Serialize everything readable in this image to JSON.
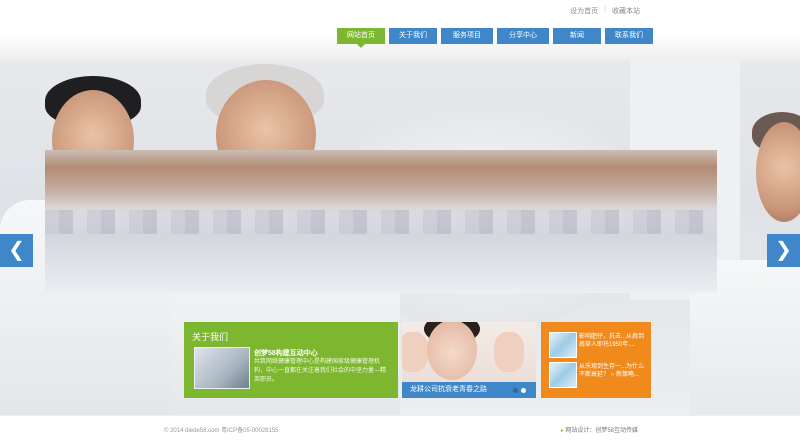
{
  "top_links": {
    "home": "设为首页",
    "favorite": "收藏本站"
  },
  "nav": [
    {
      "label": "网站首页",
      "active": true
    },
    {
      "label": "关于我们"
    },
    {
      "label": "服务项目"
    },
    {
      "label": "分享中心"
    },
    {
      "label": "新闻"
    },
    {
      "label": "联系我们"
    }
  ],
  "slider": {
    "prev": "❮",
    "next": "❯"
  },
  "about": {
    "title": "关于我们",
    "subtitle": "创梦58构建互动中心",
    "description": "共筑网络健康管理中心是构建国家级健康管理机构，中心一直都在关注着我们社会的中坚力量—精英职员。"
  },
  "feature": {
    "caption": "龙耕公司抗衰老青春之路"
  },
  "news": [
    {
      "text": "影响肥仔，抗击...从肩到肩穿人即托1950年...."
    },
    {
      "text": "从乐观到生存一...为什么不断衰延？ ○ 新策略..."
    }
  ],
  "footer": {
    "copyright": "© 2014 diede58.com 粤ICP备05-00028155",
    "design": "网站设计：创梦58互动传媒"
  },
  "colors": {
    "nav_blue": "#3f87c9",
    "active_green": "#7db72f",
    "orange": "#f08a1c"
  }
}
